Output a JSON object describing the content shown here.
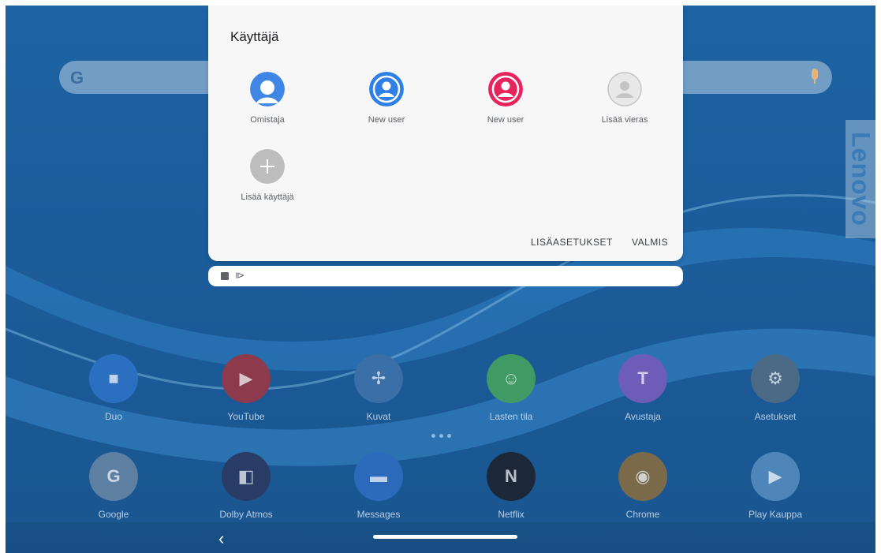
{
  "dialog": {
    "title": "Käyttäjä",
    "users": [
      {
        "label": "Omistaja",
        "color": "#3f86e5"
      },
      {
        "label": "New user",
        "color": "#2f80e6"
      },
      {
        "label": "New user",
        "color": "#e8245d"
      },
      {
        "label": "Lisää vieras",
        "color": "#bdbdbd"
      }
    ],
    "add_user_label": "Lisää käyttäjä",
    "more_settings_label": "LISÄASETUKSET",
    "done_label": "VALMIS"
  },
  "search": {
    "logo": "G"
  },
  "brand": "Lenovo",
  "apps_row1": [
    {
      "label": "Duo",
      "icon": "video-camera-icon",
      "color": "#2b6fc0"
    },
    {
      "label": "YouTube",
      "icon": "youtube-play-icon",
      "color": "#8c3a4c"
    },
    {
      "label": "Kuvat",
      "icon": "pinwheel-icon",
      "color": "#3a6fa8"
    },
    {
      "label": "Lasten tila",
      "icon": "kids-face-icon",
      "color": "#3f9a63"
    },
    {
      "label": "Avustaja",
      "icon": "lightbulb-icon",
      "color": "#6d5db8"
    },
    {
      "label": "Asetukset",
      "icon": "gear-icon",
      "color": "#4a6a86"
    }
  ],
  "apps_row2": [
    {
      "label": "Google",
      "icon": "google-folder-icon",
      "color": "#5d7fa2"
    },
    {
      "label": "Dolby Atmos",
      "icon": "dolby-icon",
      "color": "#283c66"
    },
    {
      "label": "Messages",
      "icon": "message-icon",
      "color": "#2c6bbb"
    },
    {
      "label": "Netflix",
      "icon": "netflix-icon",
      "color": "#1c2838"
    },
    {
      "label": "Chrome",
      "icon": "chrome-icon",
      "color": "#7a6a4a"
    },
    {
      "label": "Play Kauppa",
      "icon": "play-store-icon",
      "color": "#4f86b9"
    }
  ],
  "navbar": {
    "back_glyph": "‹"
  }
}
